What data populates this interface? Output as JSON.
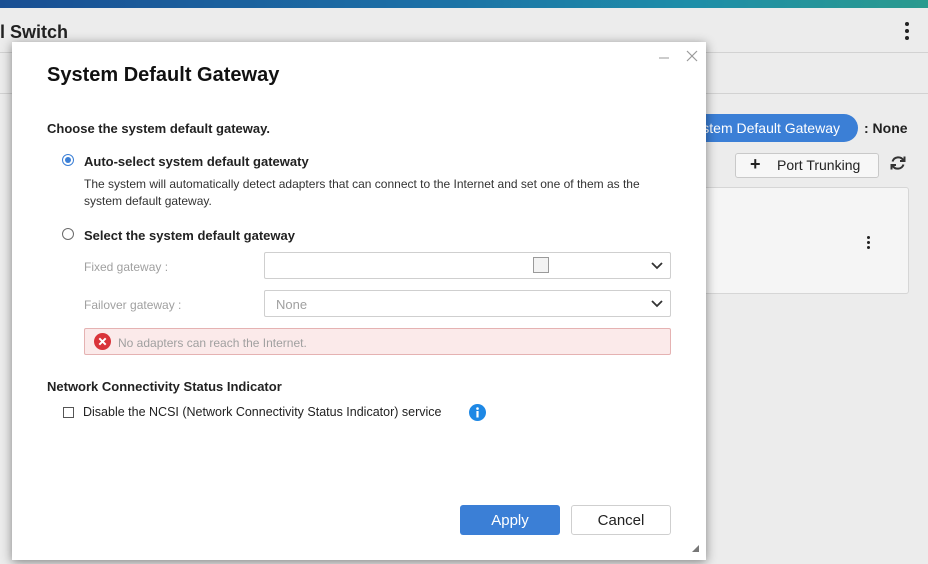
{
  "background": {
    "title": "l Switch",
    "default_gateway_button": "stem Default Gateway",
    "default_gateway_value": ": None",
    "port_trunking_button": "Port Trunking"
  },
  "dialog": {
    "title": "System Default Gateway",
    "section_heading": "Choose the system default gateway.",
    "auto_option": {
      "label": "Auto-select system default gatewaty",
      "selected": true,
      "description": "The system will automatically detect adapters that can connect to the Internet and set one of them as the system default gateway."
    },
    "manual_option": {
      "label": "Select the system default gateway",
      "selected": false
    },
    "fixed_gateway": {
      "label": "Fixed gateway :",
      "value": ""
    },
    "failover_gateway": {
      "label": "Failover gateway :",
      "value": "None"
    },
    "error_message": "No adapters can reach the Internet.",
    "ncsi": {
      "heading": "Network Connectivity Status Indicator",
      "checkbox_label": "Disable the NCSI (Network Connectivity Status Indicator) service",
      "checked": false
    },
    "apply_label": "Apply",
    "cancel_label": "Cancel"
  },
  "colors": {
    "accent": "#3b7fd6",
    "error_bg": "#fbeaea",
    "error_icon": "#d9343a",
    "info_icon": "#1e88e5"
  }
}
